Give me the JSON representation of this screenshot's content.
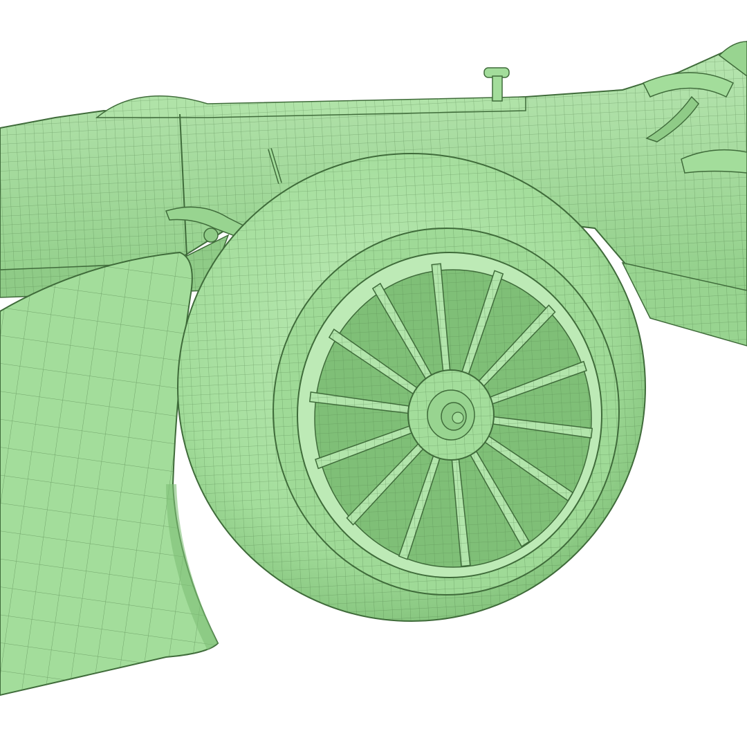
{
  "image": {
    "subject": "wireframe-render",
    "colors": {
      "background": "#ffffff",
      "mesh_fill": "#a3dd9b",
      "mesh_fill_light": "#bdeab6",
      "mesh_fill_dark": "#7fbf77",
      "wire": "#3f6b3a",
      "shadow": "#6aa463"
    },
    "wheel": {
      "spoke_count": 14
    }
  }
}
